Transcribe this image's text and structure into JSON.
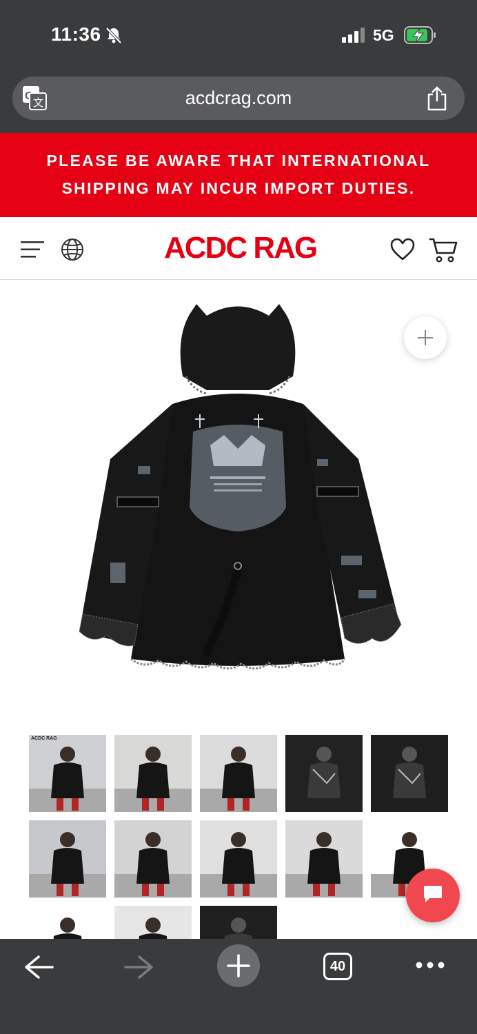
{
  "status_bar": {
    "time": "11:36",
    "network": "5G"
  },
  "browser": {
    "url": "acdcrag.com"
  },
  "notice": {
    "line1": "PLEASE BE AWARE THAT INTERNATIONAL",
    "line2": "SHIPPING MAY INCUR IMPORT DUTIES."
  },
  "site": {
    "logo": "ACDC RAG"
  },
  "product": {
    "thumbnails": [
      {
        "tag": "ACDC RAG",
        "bg": "#cfd0d3"
      },
      {
        "tag": "",
        "bg": "#d8d8d6"
      },
      {
        "tag": "",
        "bg": "#dcdcdc"
      },
      {
        "tag": "",
        "bg": "#222222"
      },
      {
        "tag": "",
        "bg": "#1e1e1e"
      },
      {
        "tag": "",
        "bg": "#c7c8cb"
      },
      {
        "tag": "",
        "bg": "#d3d3d3"
      },
      {
        "tag": "",
        "bg": "#e0e0e0"
      },
      {
        "tag": "",
        "bg": "#dadada"
      },
      {
        "tag": "",
        "bg": "#ffffff"
      },
      {
        "tag": "",
        "bg": "#ffffff"
      },
      {
        "tag": "",
        "bg": "#e6e6e6"
      },
      {
        "tag": "",
        "bg": "#1f1f1f"
      }
    ]
  },
  "toolbar": {
    "tabs_count": "40"
  },
  "colors": {
    "brand_red": "#e60014",
    "chat_red": "#f0484e",
    "chrome_dark": "#3a3b3d"
  }
}
